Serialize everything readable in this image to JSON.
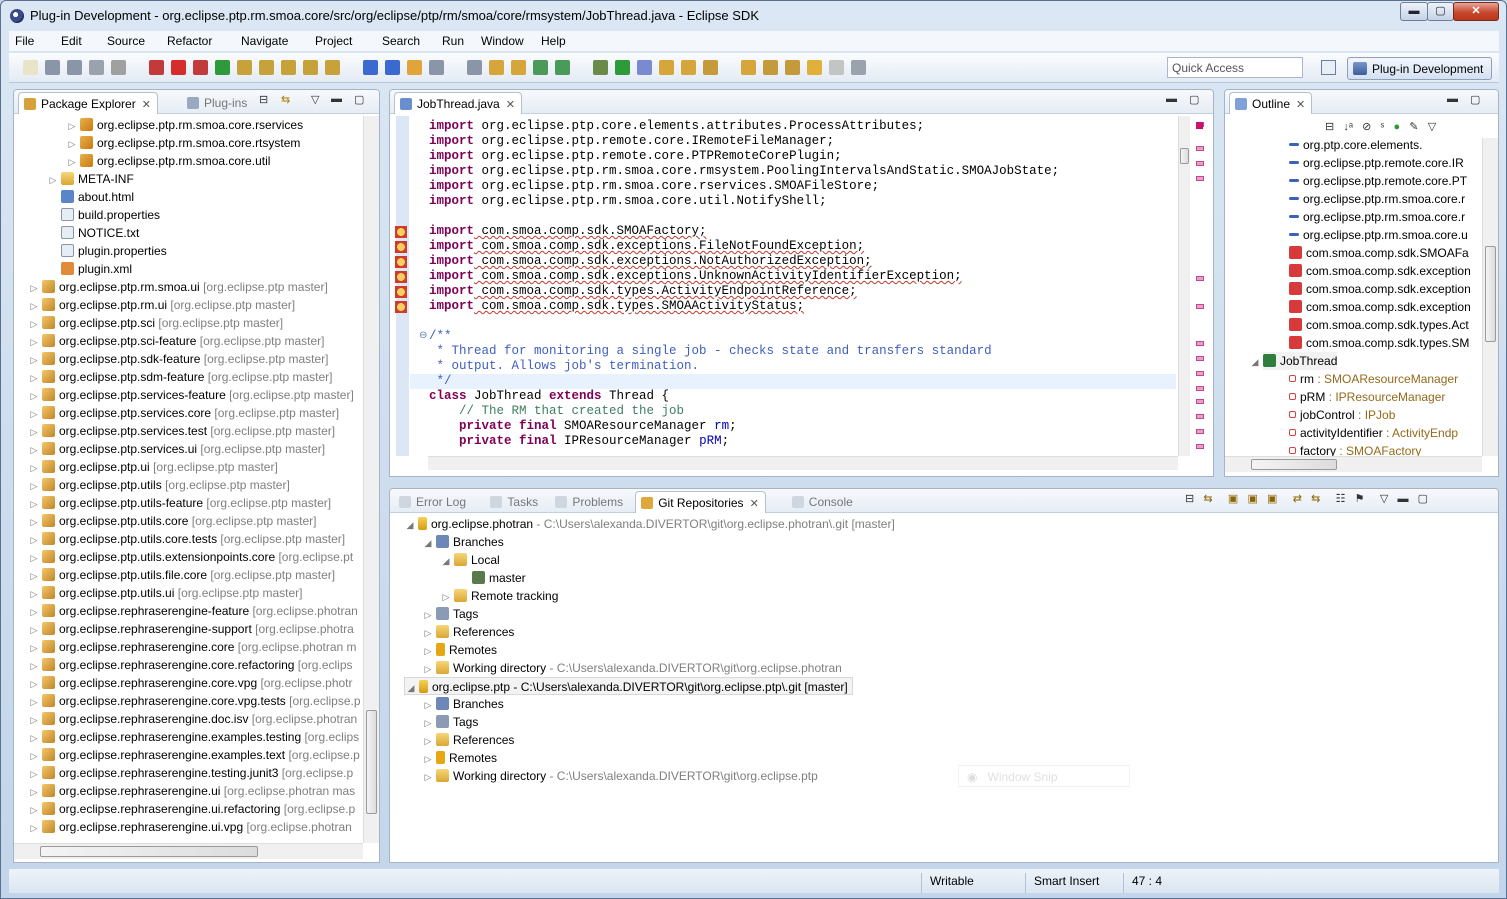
{
  "window": {
    "title": "Plug-in Development - org.eclipse.ptp.rm.smoa.core/src/org/eclipse/ptp/rm/smoa/core/rmsystem/JobThread.java - Eclipse SDK",
    "min": "▬",
    "max": "▢",
    "close": "✕"
  },
  "menu": [
    "File",
    "Edit",
    "Source",
    "Refactor",
    "Navigate",
    "Project",
    "Search",
    "Run",
    "Window",
    "Help"
  ],
  "quick_access": {
    "placeholder": "Quick Access"
  },
  "perspective": {
    "label": "Plug-in Development"
  },
  "explorer": {
    "tabs": [
      {
        "label": "Package Explorer",
        "active": true
      },
      {
        "label": "Plug-ins",
        "active": false
      }
    ],
    "rows": [
      {
        "indent": 3,
        "tw": "▷",
        "icon": "package",
        "name": "org.eclipse.ptp.rm.smoa.core.rservices",
        "git": ""
      },
      {
        "indent": 3,
        "tw": "▷",
        "icon": "package",
        "name": "org.eclipse.ptp.rm.smoa.core.rtsystem",
        "git": ""
      },
      {
        "indent": 3,
        "tw": "▷",
        "icon": "package",
        "name": "org.eclipse.ptp.rm.smoa.core.util",
        "git": ""
      },
      {
        "indent": 2,
        "tw": "▷",
        "icon": "folder",
        "name": "META-INF",
        "git": ""
      },
      {
        "indent": 2,
        "tw": "",
        "icon": "html",
        "name": "about.html",
        "git": ""
      },
      {
        "indent": 2,
        "tw": "",
        "icon": "file",
        "name": "build.properties",
        "git": ""
      },
      {
        "indent": 2,
        "tw": "",
        "icon": "file",
        "name": "NOTICE.txt",
        "git": ""
      },
      {
        "indent": 2,
        "tw": "",
        "icon": "file",
        "name": "plugin.properties",
        "git": ""
      },
      {
        "indent": 2,
        "tw": "",
        "icon": "xml",
        "name": "plugin.xml",
        "git": ""
      },
      {
        "indent": 1,
        "tw": "▷",
        "icon": "project",
        "name": "org.eclipse.ptp.rm.smoa.ui",
        "git": " [org.eclipse.ptp master]"
      },
      {
        "indent": 1,
        "tw": "▷",
        "icon": "project",
        "name": "org.eclipse.ptp.rm.ui",
        "git": " [org.eclipse.ptp master]"
      },
      {
        "indent": 1,
        "tw": "▷",
        "icon": "project",
        "name": "org.eclipse.ptp.sci",
        "git": " [org.eclipse.ptp master]"
      },
      {
        "indent": 1,
        "tw": "▷",
        "icon": "project",
        "name": "org.eclipse.ptp.sci-feature",
        "git": " [org.eclipse.ptp master]"
      },
      {
        "indent": 1,
        "tw": "▷",
        "icon": "project",
        "name": "org.eclipse.ptp.sdk-feature",
        "git": " [org.eclipse.ptp master]"
      },
      {
        "indent": 1,
        "tw": "▷",
        "icon": "project",
        "name": "org.eclipse.ptp.sdm-feature",
        "git": " [org.eclipse.ptp master]"
      },
      {
        "indent": 1,
        "tw": "▷",
        "icon": "project",
        "name": "org.eclipse.ptp.services-feature",
        "git": " [org.eclipse.ptp master]"
      },
      {
        "indent": 1,
        "tw": "▷",
        "icon": "project",
        "name": "org.eclipse.ptp.services.core",
        "git": " [org.eclipse.ptp master]"
      },
      {
        "indent": 1,
        "tw": "▷",
        "icon": "project",
        "name": "org.eclipse.ptp.services.test",
        "git": " [org.eclipse.ptp master]"
      },
      {
        "indent": 1,
        "tw": "▷",
        "icon": "project",
        "name": "org.eclipse.ptp.services.ui",
        "git": " [org.eclipse.ptp master]"
      },
      {
        "indent": 1,
        "tw": "▷",
        "icon": "project",
        "name": "org.eclipse.ptp.ui",
        "git": " [org.eclipse.ptp master]"
      },
      {
        "indent": 1,
        "tw": "▷",
        "icon": "project",
        "name": "org.eclipse.ptp.utils",
        "git": " [org.eclipse.ptp master]"
      },
      {
        "indent": 1,
        "tw": "▷",
        "icon": "project",
        "name": "org.eclipse.ptp.utils-feature",
        "git": " [org.eclipse.ptp master]"
      },
      {
        "indent": 1,
        "tw": "▷",
        "icon": "project",
        "name": "org.eclipse.ptp.utils.core",
        "git": " [org.eclipse.ptp master]"
      },
      {
        "indent": 1,
        "tw": "▷",
        "icon": "project",
        "name": "org.eclipse.ptp.utils.core.tests",
        "git": " [org.eclipse.ptp master]"
      },
      {
        "indent": 1,
        "tw": "▷",
        "icon": "project",
        "name": "org.eclipse.ptp.utils.extensionpoints.core",
        "git": " [org.eclipse.pt"
      },
      {
        "indent": 1,
        "tw": "▷",
        "icon": "project",
        "name": "org.eclipse.ptp.utils.file.core",
        "git": " [org.eclipse.ptp master]"
      },
      {
        "indent": 1,
        "tw": "▷",
        "icon": "project",
        "name": "org.eclipse.ptp.utils.ui",
        "git": " [org.eclipse.ptp master]"
      },
      {
        "indent": 1,
        "tw": "▷",
        "icon": "project",
        "name": "org.eclipse.rephraserengine-feature",
        "git": " [org.eclipse.photran"
      },
      {
        "indent": 1,
        "tw": "▷",
        "icon": "project",
        "name": "org.eclipse.rephraserengine-support",
        "git": " [org.eclipse.photra"
      },
      {
        "indent": 1,
        "tw": "▷",
        "icon": "project",
        "name": "org.eclipse.rephraserengine.core",
        "git": " [org.eclipse.photran m"
      },
      {
        "indent": 1,
        "tw": "▷",
        "icon": "project",
        "name": "org.eclipse.rephraserengine.core.refactoring",
        "git": " [org.eclips"
      },
      {
        "indent": 1,
        "tw": "▷",
        "icon": "project",
        "name": "org.eclipse.rephraserengine.core.vpg",
        "git": " [org.eclipse.photr"
      },
      {
        "indent": 1,
        "tw": "▷",
        "icon": "project",
        "name": "org.eclipse.rephraserengine.core.vpg.tests",
        "git": " [org.eclipse.p"
      },
      {
        "indent": 1,
        "tw": "▷",
        "icon": "project",
        "name": "org.eclipse.rephraserengine.doc.isv",
        "git": " [org.eclipse.photran"
      },
      {
        "indent": 1,
        "tw": "▷",
        "icon": "project",
        "name": "org.eclipse.rephraserengine.examples.testing",
        "git": " [org.eclips"
      },
      {
        "indent": 1,
        "tw": "▷",
        "icon": "project",
        "name": "org.eclipse.rephraserengine.examples.text",
        "git": " [org.eclipse.p"
      },
      {
        "indent": 1,
        "tw": "▷",
        "icon": "project",
        "name": "org.eclipse.rephraserengine.testing.junit3",
        "git": " [org.eclipse.p"
      },
      {
        "indent": 1,
        "tw": "▷",
        "icon": "project",
        "name": "org.eclipse.rephraserengine.ui",
        "git": " [org.eclipse.photran mas"
      },
      {
        "indent": 1,
        "tw": "▷",
        "icon": "project",
        "name": "org.eclipse.rephraserengine.ui.refactoring",
        "git": " [org.eclipse.p"
      },
      {
        "indent": 1,
        "tw": "▷",
        "icon": "project",
        "name": "org.eclipse.rephraserengine.ui.vpg",
        "git": " [org.eclipse.photran"
      }
    ]
  },
  "editor": {
    "tab": {
      "label": "JobThread.java"
    },
    "lines": [
      {
        "t": "import",
        "r": " org.eclipse.ptp.core.elements.attributes.ProcessAttributes;",
        "w": false
      },
      {
        "t": "import",
        "r": " org.eclipse.ptp.remote.core.IRemoteFileManager;",
        "w": false
      },
      {
        "t": "import",
        "r": " org.eclipse.ptp.remote.core.PTPRemoteCorePlugin;",
        "w": false
      },
      {
        "t": "import",
        "r": " org.eclipse.ptp.rm.smoa.core.rmsystem.PoolingIntervalsAndStatic.SMOAJobState;",
        "w": false
      },
      {
        "t": "import",
        "r": " org.eclipse.ptp.rm.smoa.core.rservices.SMOAFileStore;",
        "w": false
      },
      {
        "t": "import",
        "r": " org.eclipse.ptp.rm.smoa.core.util.NotifyShell;",
        "w": false
      },
      {
        "t": "",
        "r": "",
        "w": false
      },
      {
        "t": "import",
        "r": " com.smoa.comp.sdk.SMOAFactory;",
        "w": true
      },
      {
        "t": "import",
        "r": " com.smoa.comp.sdk.exceptions.FileNotFoundException;",
        "w": true
      },
      {
        "t": "import",
        "r": " com.smoa.comp.sdk.exceptions.NotAuthorizedException;",
        "w": true
      },
      {
        "t": "import",
        "r": " com.smoa.comp.sdk.exceptions.UnknownActivityIdentifierException;",
        "w": true
      },
      {
        "t": "import",
        "r": " com.smoa.comp.sdk.types.ActivityEndpointReference;",
        "w": true
      },
      {
        "t": "import",
        "r": " com.smoa.comp.sdk.types.SMOAActivityStatus;",
        "w": true
      }
    ],
    "doc": [
      "/**",
      " * Thread for monitoring a single job - checks state and transfers standard",
      " * output. Allows job's termination.",
      " */"
    ],
    "cls": {
      "kw1": "class",
      "name": " JobThread ",
      "kw2": "extends",
      "rest": " Thread {"
    },
    "comment": "    // The RM that created the job",
    "f1": {
      "kw": "    private final",
      "type": " SMOAResourceManager ",
      "name": "rm",
      "end": ";"
    },
    "f2": {
      "kw": "    private final",
      "type": " IPResourceManager ",
      "name": "pRM",
      "end": ";"
    },
    "fold": "⊖"
  },
  "outline": {
    "tab": {
      "label": "Outline"
    },
    "rows": [
      {
        "x": 70,
        "icon": "import",
        "name": "org.ptp.core.elements.",
        "rest": ""
      },
      {
        "x": 70,
        "icon": "import",
        "name": "org.eclipse.ptp.remote.core.IR",
        "rest": ""
      },
      {
        "x": 70,
        "icon": "import",
        "name": "org.eclipse.ptp.remote.core.PT",
        "rest": ""
      },
      {
        "x": 70,
        "icon": "import",
        "name": "org.eclipse.ptp.rm.smoa.core.r",
        "rest": ""
      },
      {
        "x": 70,
        "icon": "import",
        "name": "org.eclipse.ptp.rm.smoa.core.r",
        "rest": ""
      },
      {
        "x": 70,
        "icon": "import",
        "name": "org.eclipse.ptp.rm.smoa.core.u",
        "rest": ""
      },
      {
        "x": 70,
        "icon": "err",
        "name": "com.smoa.comp.sdk.SMOAFa",
        "rest": ""
      },
      {
        "x": 70,
        "icon": "err",
        "name": "com.smoa.comp.sdk.exception",
        "rest": ""
      },
      {
        "x": 70,
        "icon": "err",
        "name": "com.smoa.comp.sdk.exception",
        "rest": ""
      },
      {
        "x": 70,
        "icon": "err",
        "name": "com.smoa.comp.sdk.exception",
        "rest": ""
      },
      {
        "x": 70,
        "icon": "err",
        "name": "com.smoa.comp.sdk.types.Act",
        "rest": ""
      },
      {
        "x": 70,
        "icon": "err",
        "name": "com.smoa.comp.sdk.types.SM",
        "rest": ""
      },
      {
        "x": 46,
        "icon": "class",
        "name": "JobThread",
        "rest": ""
      },
      {
        "x": 70,
        "icon": "field",
        "name": "rm",
        "rest": " : SMOAResourceManager"
      },
      {
        "x": 70,
        "icon": "field",
        "name": "pRM",
        "rest": " : IPResourceManager"
      },
      {
        "x": 70,
        "icon": "field",
        "name": "jobControl",
        "rest": " : IPJob"
      },
      {
        "x": 70,
        "icon": "errfield",
        "name": "activityIdentifier",
        "rest": " : ActivityEndp"
      },
      {
        "x": 70,
        "icon": "errfield",
        "name": "factory",
        "rest": " : SMOAFactory"
      }
    ]
  },
  "bottom": {
    "tabs": [
      {
        "label": "Error Log",
        "active": false
      },
      {
        "label": "Tasks",
        "active": false
      },
      {
        "label": "Problems",
        "active": false
      },
      {
        "label": "Git Repositories",
        "active": true
      },
      {
        "label": "Console",
        "active": false
      }
    ],
    "rows": [
      {
        "indent": 0,
        "tw": "◢",
        "icon": "repo",
        "name": "org.eclipse.photran",
        "path": " - C:\\Users\\alexanda.DIVERTOR\\git\\org.eclipse.photran\\.git [master]",
        "sel": false
      },
      {
        "indent": 1,
        "tw": "◢",
        "icon": "branch",
        "name": "Branches",
        "path": "",
        "sel": false
      },
      {
        "indent": 2,
        "tw": "◢",
        "icon": "folder",
        "name": "Local",
        "path": "",
        "sel": false
      },
      {
        "indent": 3,
        "tw": "",
        "icon": "check",
        "name": "master",
        "path": "",
        "sel": false
      },
      {
        "indent": 2,
        "tw": "▷",
        "icon": "folder",
        "name": "Remote tracking",
        "path": "",
        "sel": false
      },
      {
        "indent": 1,
        "tw": "▷",
        "icon": "tag",
        "name": "Tags",
        "path": "",
        "sel": false
      },
      {
        "indent": 1,
        "tw": "▷",
        "icon": "folder",
        "name": "References",
        "path": "",
        "sel": false
      },
      {
        "indent": 1,
        "tw": "▷",
        "icon": "remote",
        "name": "Remotes",
        "path": "",
        "sel": false
      },
      {
        "indent": 1,
        "tw": "▷",
        "icon": "folder",
        "name": "Working directory",
        "path": " - C:\\Users\\alexanda.DIVERTOR\\git\\org.eclipse.photran",
        "sel": false
      },
      {
        "indent": 0,
        "tw": "◢",
        "icon": "repo",
        "name": "org.eclipse.ptp",
        "path": " - C:\\Users\\alexanda.DIVERTOR\\git\\org.eclipse.ptp\\.git [master]",
        "sel": true
      },
      {
        "indent": 1,
        "tw": "▷",
        "icon": "branch",
        "name": "Branches",
        "path": "",
        "sel": false
      },
      {
        "indent": 1,
        "tw": "▷",
        "icon": "tag",
        "name": "Tags",
        "path": "",
        "sel": false
      },
      {
        "indent": 1,
        "tw": "▷",
        "icon": "folder",
        "name": "References",
        "path": "",
        "sel": false
      },
      {
        "indent": 1,
        "tw": "▷",
        "icon": "remote",
        "name": "Remotes",
        "path": "",
        "sel": false
      },
      {
        "indent": 1,
        "tw": "▷",
        "icon": "folder",
        "name": "Working directory",
        "path": " - C:\\Users\\alexanda.DIVERTOR\\git\\org.eclipse.ptp",
        "sel": false
      }
    ],
    "ghost": "Window Snip"
  },
  "status": {
    "writable": "Writable",
    "insert": "Smart Insert",
    "position": "47 : 4"
  }
}
